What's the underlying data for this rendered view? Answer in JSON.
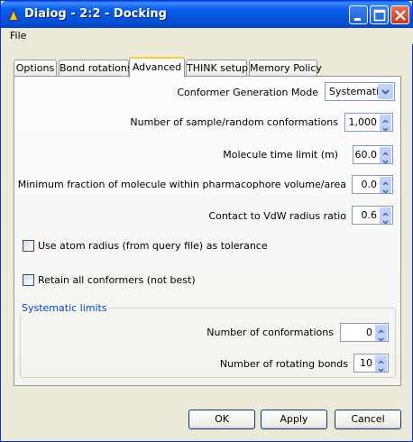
{
  "window": {
    "title": "Dialog - 2:2 - Docking"
  },
  "menu": {
    "file": "File"
  },
  "tabs": [
    {
      "label": "Options"
    },
    {
      "label": "Bond rotations"
    },
    {
      "label": "Advanced"
    },
    {
      "label": "THINK setup"
    },
    {
      "label": "Memory Policy"
    }
  ],
  "active_tab": "Advanced",
  "advanced": {
    "conformer_mode_label": "Conformer Generation Mode",
    "conformer_mode_value": "Systematic",
    "sample_label": "Number of sample/random conformations",
    "sample_value": "1,000",
    "time_label": "Molecule time limit (m)",
    "time_value": "60.0",
    "fraction_label": "Minimum fraction of molecule within pharmacophore volume/area",
    "fraction_value": "0.0",
    "contact_label": "Contact to VdW radius ratio",
    "contact_value": "0.6",
    "atom_radius_label": "Use atom radius (from query file) as tolerance",
    "atom_radius_checked": false,
    "retain_label": "Retain all conformers (not best)",
    "retain_checked": false
  },
  "systematic": {
    "title": "Systematic limits",
    "conformations_label": "Number of conformations",
    "conformations_value": "0",
    "bonds_label": "Number of rotating bonds",
    "bonds_value": "10"
  },
  "buttons": {
    "ok": "OK",
    "apply": "Apply",
    "cancel": "Cancel"
  },
  "colors": {
    "titlebar": "#0a5ef0",
    "group_title": "#0046d5",
    "active_tab_accent": "#ffc83c"
  }
}
